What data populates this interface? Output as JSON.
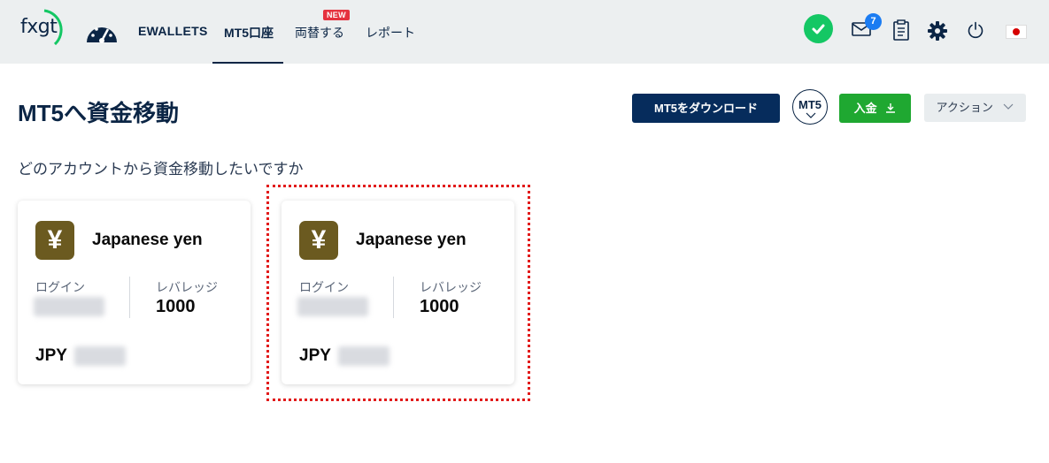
{
  "brand": {
    "logo_text": "fxgt"
  },
  "nav": {
    "ewallets": "EWALLETS",
    "mt5_account": "MT5口座",
    "exchange": "両替する",
    "exchange_badge": "NEW",
    "report": "レポート"
  },
  "header_icons": {
    "verified": "check-icon",
    "mail": "mail-icon",
    "mail_count": "7",
    "clipboard": "clipboard-icon",
    "settings": "gear-icon",
    "logout": "power-icon",
    "language": "japan-flag-icon"
  },
  "page": {
    "title": "MT5へ資金移動",
    "download_button": "MT5をダウンロード",
    "platform_selector": "MT5",
    "deposit_button": "入金",
    "actions_button": "アクション",
    "subtitle": "どのアカウントから資金移動したいですか"
  },
  "accounts": [
    {
      "currency_name": "Japanese yen",
      "currency_symbol": "¥",
      "login_label": "ログイン",
      "leverage_label": "レバレッジ",
      "leverage": "1000",
      "currency_code": "JPY"
    },
    {
      "currency_name": "Japanese yen",
      "currency_symbol": "¥",
      "login_label": "ログイン",
      "leverage_label": "レバレッジ",
      "leverage": "1000",
      "currency_code": "JPY"
    }
  ],
  "colors": {
    "topbar": "#eceff0",
    "navy": "#0b2545",
    "primary_button": "#062c5c",
    "deposit_green": "#1fa831",
    "verified_green": "#14c764",
    "currency_icon": "#6b5a20",
    "highlight_red": "#e21b1b"
  }
}
